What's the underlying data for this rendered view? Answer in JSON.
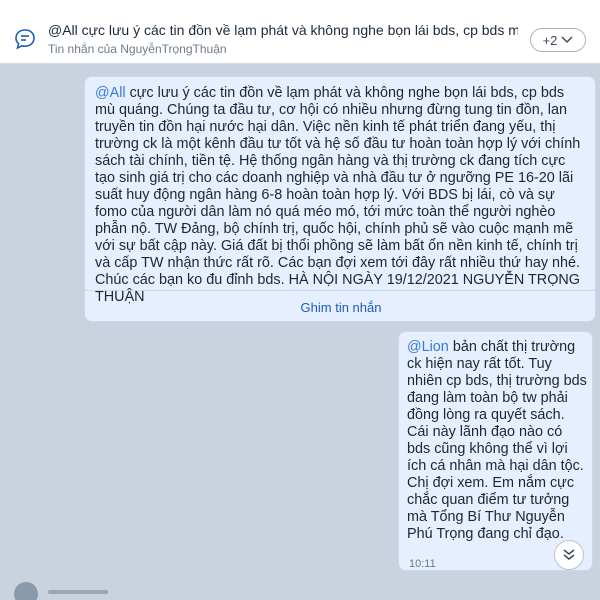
{
  "pinned": {
    "icon": "chat-bubble-icon",
    "title": "@All cực lưu ý các tin đồn về lạm phát và không nghe bọn lái bds, cp bds mù quán...",
    "subtitle": "Tin nhắn của NguyễnTrọngThuận",
    "more_label": "+2"
  },
  "messages": [
    {
      "mention": "@All",
      "text": " cực lưu ý các tin đồn về lạm phát và không nghe bọn lái bds, cp bds mù quáng. Chúng ta đầu tư, cơ hội có nhiều nhưng đừng tung tin đồn, lan truyền tin đồn hại nước hại dân. Việc nền kinh tế phát triển đang yếu, thị trường ck là một kênh đầu tư tốt và hệ số đầu tư hoàn toàn hợp lý với chính sách tài chính, tiền tệ. Hệ thống ngân hàng và thị trường ck đang tích cực tạo sinh giá trị cho các doanh nghiệp và nhà đầu tư ở ngưỡng PE 16-20 lãi suất huy động ngân hàng 6-8 hoàn toàn hợp lý. Với BDS bị lái, cò và sự fomo của người dân làm nó quá méo mó, tới mức toàn thể người nghèo phẫn nộ. TW Đảng, bộ chính trị, quốc hội, chính phủ sẽ vào cuộc mạnh mẽ với sự bất cập này. Giá đất bị thổi phồng sẽ làm bất ổn nền kinh tế, chính trị và cấp TW nhận thức rất rõ. Các bạn đợi xem tới đây rất nhiều thứ hay nhé. Chúc các bạn ko đu đỉnh bds. HÀ NỘI NGÀY 19/12/2021 NGUYỄN TRỌNG THUẬN",
      "action": "Ghim tin nhắn"
    },
    {
      "mention": "@Lion",
      "text": " bản chất thị trường ck hiện nay rất tốt. Tuy nhiên cp bds, thị trường bds đang làm toàn bộ tw phải đồng lòng ra quyết sách. Cái này lãnh đạo nào có bds cũng không thể vì lợi ích cá nhân mà hại dân tộc. Chị đợi xem. Em nắm cực chắc quan điểm tư tưởng mà Tổng Bí Thư Nguyễn Phú Trọng đang chỉ đạo.",
      "time": "10:11"
    }
  ],
  "colors": {
    "background": "#c9d3df",
    "bubble": "#e5efff",
    "mention": "#3a7bd5",
    "action": "#1a5fb4"
  }
}
